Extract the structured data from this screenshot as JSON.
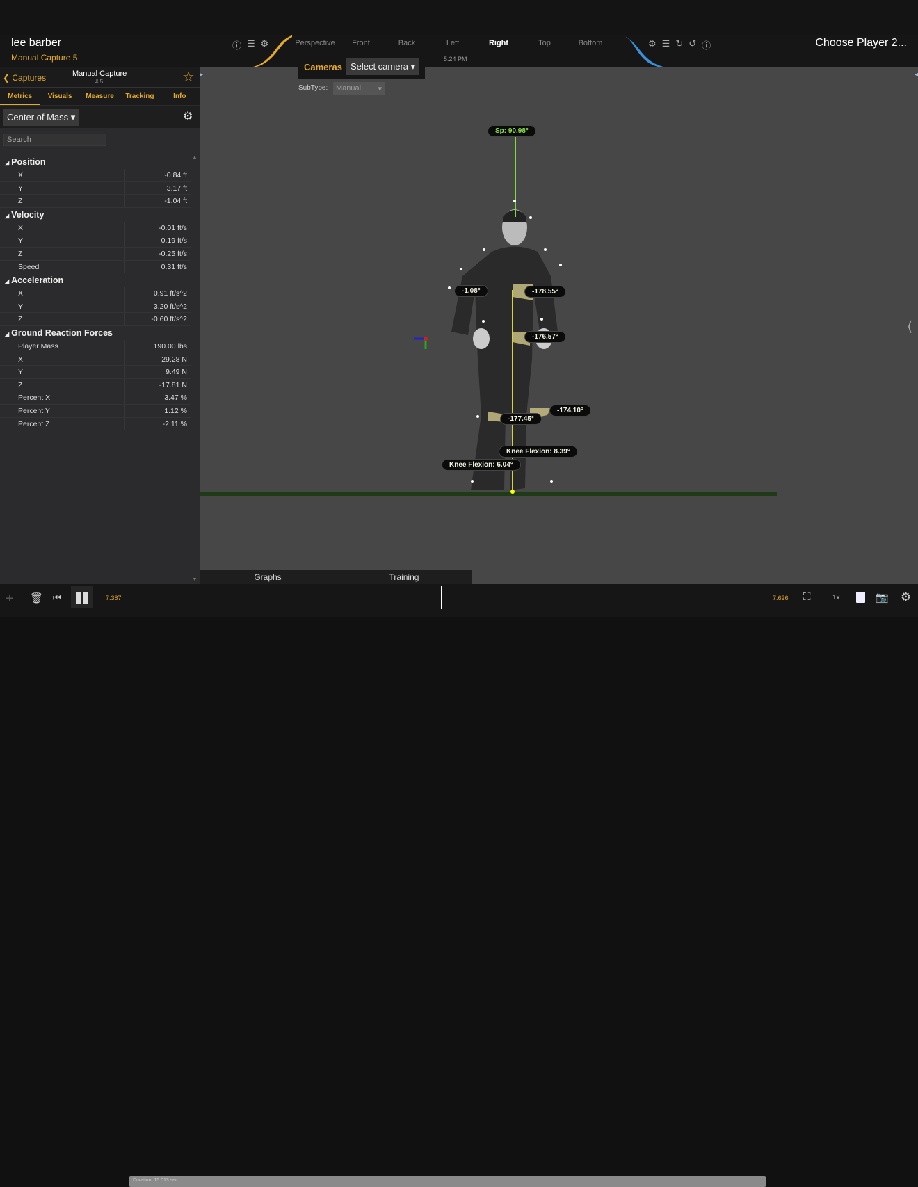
{
  "header": {
    "player_name": "lee barber",
    "capture_name": "Manual Capture 5",
    "player2": "Choose Player 2...",
    "time": "5:24 PM"
  },
  "view_tabs": [
    {
      "label": "Perspective"
    },
    {
      "label": "Front"
    },
    {
      "label": "Back"
    },
    {
      "label": "Left"
    },
    {
      "label": "Right",
      "active": true
    },
    {
      "label": "Top"
    },
    {
      "label": "Bottom"
    }
  ],
  "cameras": {
    "label": "Cameras",
    "value": "Select camera",
    "subtype_label": "SubType:",
    "subtype_value": "Manual"
  },
  "panel": {
    "back_label": "Captures",
    "capture_title": "Manual Capture",
    "capture_number": "# 5",
    "tabs": [
      "Metrics",
      "Visuals",
      "Measure",
      "Tracking",
      "Info"
    ],
    "dropdown": "Center of Mass",
    "search_placeholder": "Search",
    "sections": [
      {
        "title": "Position",
        "rows": [
          [
            "X",
            "-0.84 ft"
          ],
          [
            "Y",
            "3.17 ft"
          ],
          [
            "Z",
            "-1.04 ft"
          ]
        ]
      },
      {
        "title": "Velocity",
        "rows": [
          [
            "X",
            "-0.01 ft/s"
          ],
          [
            "Y",
            "0.19 ft/s"
          ],
          [
            "Z",
            "-0.25 ft/s"
          ],
          [
            "Speed",
            "0.31 ft/s"
          ]
        ]
      },
      {
        "title": "Acceleration",
        "rows": [
          [
            "X",
            "0.91 ft/s^2"
          ],
          [
            "Y",
            "3.20 ft/s^2"
          ],
          [
            "Z",
            "-0.60 ft/s^2"
          ]
        ]
      },
      {
        "title": "Ground Reaction Forces",
        "rows": [
          [
            "Player Mass",
            "190.00 lbs"
          ],
          [
            "X",
            "29.28 N"
          ],
          [
            "Y",
            "9.49 N"
          ],
          [
            "Z",
            "-17.81 N"
          ],
          [
            "Percent X",
            "3.47 %"
          ],
          [
            "Percent Y",
            "1.12 %"
          ],
          [
            "Percent Z",
            "-2.11 %"
          ]
        ]
      }
    ]
  },
  "annotations": {
    "spine": "Sp: 90.98°",
    "shoulder_left": "-1.08°",
    "shoulder_right": "-178.55°",
    "hip": "-176.57°",
    "knee_left": "-177.45°",
    "knee_right": "-174.10°",
    "knee_flexion_right": "Knee Flexion: 8.39°",
    "knee_flexion_left": "Knee Flexion: 6.04°"
  },
  "bottom": {
    "tabs": [
      "Graphs",
      "Training"
    ],
    "current_time": "7.387",
    "end_time": "7.626",
    "duration": "Duration: 15.013 sec",
    "speed": "1x",
    "playhead_fraction": 0.49
  },
  "colors": {
    "accent": "#e3a92a",
    "secondary": "#3a8fd9",
    "spine": "#7ddc3a"
  }
}
